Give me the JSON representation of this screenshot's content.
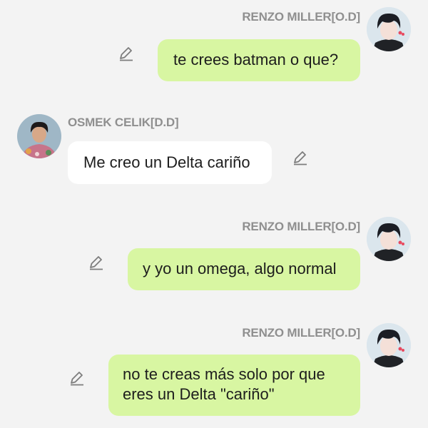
{
  "messages": [
    {
      "side": "right",
      "sender": "RENZO MILLER[O.D]",
      "avatar": "boy-dark-hair-red-heart-avatar",
      "text": "te crees batman o que?",
      "bubble_color": "#d8f6a2"
    },
    {
      "side": "left",
      "sender": "OSMEK CELIK[D.D]",
      "avatar": "man-floral-shirt-photo-avatar",
      "text": "Me creo un Delta cariño",
      "bubble_color": "#ffffff"
    },
    {
      "side": "right",
      "sender": "RENZO MILLER[O.D]",
      "avatar": "boy-dark-hair-red-heart-avatar",
      "text": "y yo un omega, algo normal",
      "bubble_color": "#d8f6a2"
    },
    {
      "side": "right",
      "sender": "RENZO MILLER[O.D]",
      "avatar": "boy-dark-hair-red-heart-avatar",
      "text": "no te creas más solo por que\neres un Delta \"cariño\"",
      "bubble_color": "#d8f6a2"
    }
  ],
  "icons": {
    "edit": "pencil-edit-icon"
  }
}
